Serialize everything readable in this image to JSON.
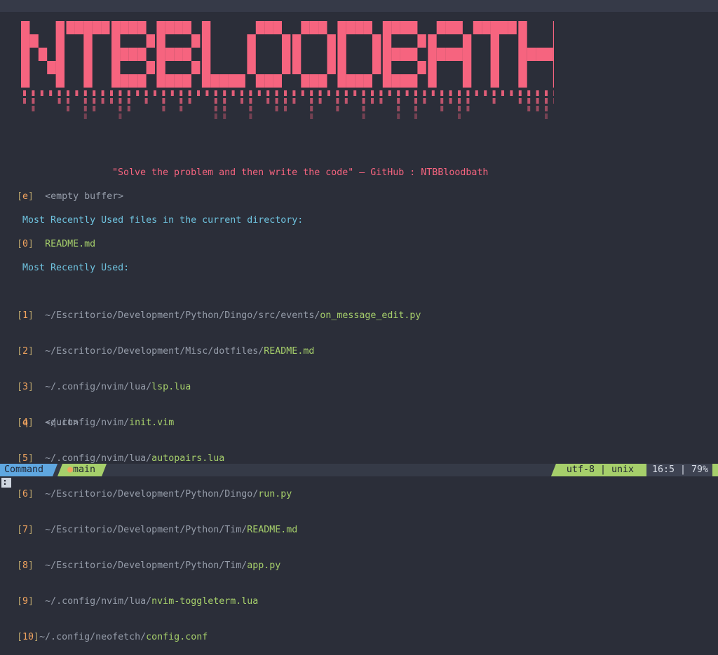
{
  "banner": {
    "text": "NTBBLOODBATH"
  },
  "quote": "\"Solve the problem and then write the code\" — GitHub : NTBBloodbath",
  "empty_buffer": {
    "key": "e",
    "label": "<empty buffer>"
  },
  "cwd_heading": "Most Recently Used files in the current directory:",
  "cwd_files": [
    {
      "key": "0",
      "dir": "",
      "file": "README.md"
    }
  ],
  "mru_heading": "Most Recently Used:",
  "mru_files": [
    {
      "key": "1",
      "dir": "~/Escritorio/Development/Python/Dingo/src/events/",
      "file": "on_message_edit.py"
    },
    {
      "key": "2",
      "dir": "~/Escritorio/Development/Misc/dotfiles/",
      "file": "README.md"
    },
    {
      "key": "3",
      "dir": "~/.config/nvim/lua/",
      "file": "lsp.lua"
    },
    {
      "key": "4",
      "dir": "~/.config/nvim/",
      "file": "init.vim"
    },
    {
      "key": "5",
      "dir": "~/.config/nvim/lua/",
      "file": "autopairs.lua"
    },
    {
      "key": "6",
      "dir": "~/Escritorio/Development/Python/Dingo/",
      "file": "run.py"
    },
    {
      "key": "7",
      "dir": "~/Escritorio/Development/Python/Tim/",
      "file": "README.md"
    },
    {
      "key": "8",
      "dir": "~/Escritorio/Development/Python/Tim/",
      "file": "app.py"
    },
    {
      "key": "9",
      "dir": "~/.config/nvim/lua/",
      "file": "nvim-toggleterm.lua"
    },
    {
      "key": "10",
      "dir": "~/.config/neofetch/",
      "file": "config.conf"
    }
  ],
  "quit": {
    "key": "q",
    "label": "<quit>"
  },
  "statusline": {
    "mode": "Command",
    "branch_icon": "git-branch-dot",
    "branch": "main",
    "encoding": "utf-8 | unix",
    "position": "16:5 | 79%"
  },
  "cmdline": ":",
  "colors": {
    "background": "#2b2e39",
    "banner": "#f6647f",
    "filename": "#a6cf6b",
    "heading": "#6fc3df",
    "index": "#f0a35e",
    "mode_bg": "#5fa7e0"
  }
}
